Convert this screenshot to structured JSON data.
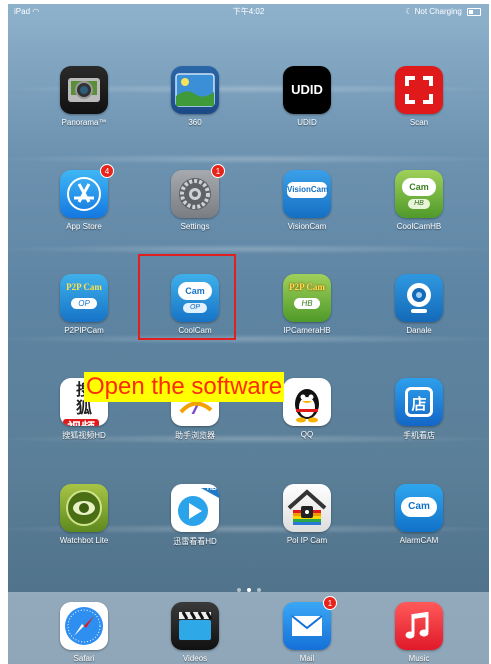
{
  "status_bar": {
    "device": "iPad",
    "time": "下午4:02",
    "charging": "Not Charging"
  },
  "home_rows": [
    [
      {
        "label": "Panorama™",
        "badge": ""
      },
      {
        "label": "360",
        "badge": ""
      },
      {
        "label": "UDID",
        "badge": "",
        "icon_text": "UDID"
      },
      {
        "label": "Scan",
        "badge": ""
      }
    ],
    [
      {
        "label": "App Store",
        "badge": "4"
      },
      {
        "label": "Settings",
        "badge": "1"
      },
      {
        "label": "VisionCam",
        "badge": "",
        "icon_text": "VisionCam"
      },
      {
        "label": "CoolCamHB",
        "badge": "",
        "icon_text": "HB"
      }
    ],
    [
      {
        "label": "P2PIPCam",
        "badge": "",
        "icon_text": "P2P Cam"
      },
      {
        "label": "CoolCam",
        "badge": "",
        "icon_text": "OP"
      },
      {
        "label": "IPCameraHB",
        "badge": "",
        "icon_text": "P2P Cam"
      },
      {
        "label": "Danale",
        "badge": ""
      }
    ],
    [
      {
        "label": "搜狐视频HD",
        "badge": "",
        "icon_text": "搜狐 视频"
      },
      {
        "label": "助手浏览器",
        "badge": ""
      },
      {
        "label": "QQ",
        "badge": ""
      },
      {
        "label": "手机看店",
        "badge": "",
        "icon_text": "店"
      }
    ],
    [
      {
        "label": "Watchbot Lite",
        "badge": ""
      },
      {
        "label": "迅雷看看HD",
        "badge": "",
        "icon_text": "HD"
      },
      {
        "label": "Pol IP Cam",
        "badge": ""
      },
      {
        "label": "AlarmCAM",
        "badge": ""
      }
    ]
  ],
  "dock": [
    {
      "label": "Safari",
      "badge": ""
    },
    {
      "label": "Videos",
      "badge": ""
    },
    {
      "label": "Mail",
      "badge": "1"
    },
    {
      "label": "Music",
      "badge": ""
    }
  ],
  "annotation": {
    "text": "Open the software"
  },
  "colors": {
    "highlight_box": "#e02020",
    "callout_bg": "#ffff00",
    "callout_text": "#ff2a00",
    "badge": "#e8231c"
  }
}
